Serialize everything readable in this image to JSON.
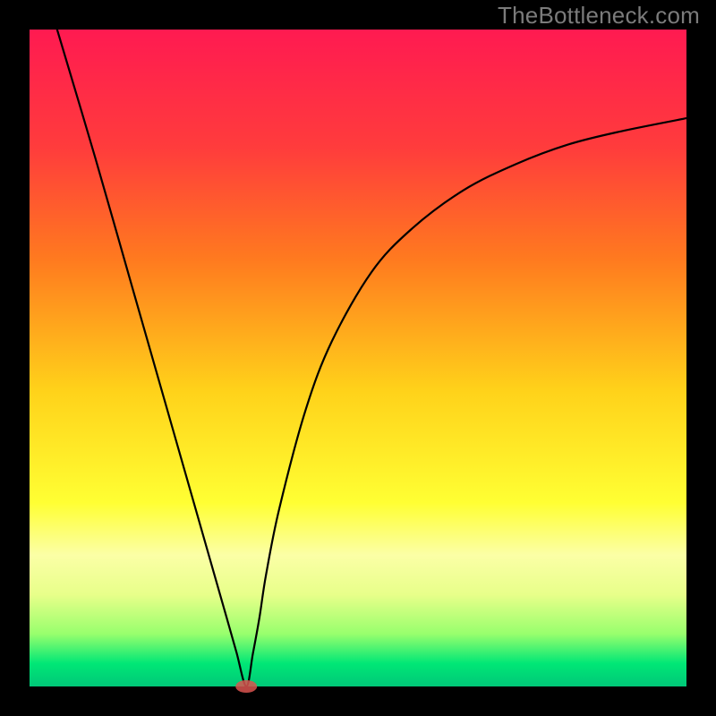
{
  "watermark": "TheBottleneck.com",
  "chart_data": {
    "type": "line",
    "title": "",
    "xlabel": "",
    "ylabel": "",
    "xlim": [
      0,
      100
    ],
    "ylim": [
      0,
      100
    ],
    "axes_visible": false,
    "background_gradient": {
      "type": "vertical",
      "stops": [
        {
          "pos": 0.0,
          "color": "#ff1a51"
        },
        {
          "pos": 0.18,
          "color": "#ff3c3c"
        },
        {
          "pos": 0.35,
          "color": "#ff7a1f"
        },
        {
          "pos": 0.55,
          "color": "#ffd21a"
        },
        {
          "pos": 0.72,
          "color": "#ffff33"
        },
        {
          "pos": 0.8,
          "color": "#fbffa6"
        },
        {
          "pos": 0.86,
          "color": "#e8ff8a"
        },
        {
          "pos": 0.92,
          "color": "#98ff6d"
        },
        {
          "pos": 0.965,
          "color": "#00e776"
        },
        {
          "pos": 1.0,
          "color": "#00c878"
        }
      ]
    },
    "series": [
      {
        "name": "bottleneck-curve",
        "x": [
          4.2,
          10,
          15,
          20,
          25,
          28,
          30,
          31.5,
          33,
          34,
          35,
          36,
          38,
          42,
          46,
          52,
          58,
          66,
          74,
          82,
          90,
          100
        ],
        "y": [
          100,
          80.5,
          63,
          45.5,
          28,
          17.5,
          10.5,
          5.2,
          0,
          5,
          10.5,
          17,
          27,
          42,
          52.5,
          63,
          69.5,
          75.5,
          79.5,
          82.5,
          84.5,
          86.5
        ]
      }
    ],
    "marker": {
      "x_pct": 33.0,
      "y_pct": 0.0,
      "color": "#d9534f"
    }
  }
}
